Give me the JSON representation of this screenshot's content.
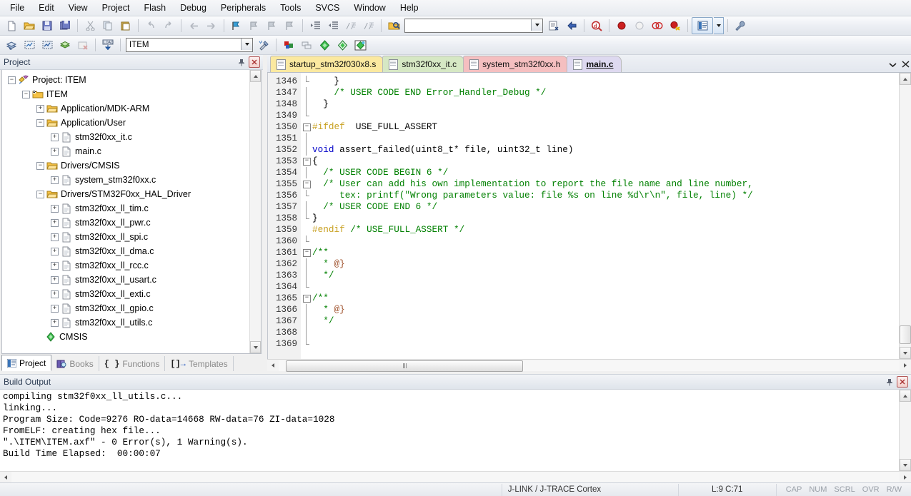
{
  "menubar": {
    "items": [
      "File",
      "Edit",
      "View",
      "Project",
      "Flash",
      "Debug",
      "Peripherals",
      "Tools",
      "SVCS",
      "Window",
      "Help"
    ]
  },
  "toolbar_main": {
    "icons": [
      {
        "name": "new-file-icon",
        "glyph": "⬜"
      },
      {
        "name": "open-file-icon",
        "glyph": "📂"
      },
      {
        "name": "save-icon",
        "glyph": "💾"
      },
      {
        "name": "save-all-icon",
        "glyph": "🖫"
      },
      {
        "name": "cut-icon",
        "glyph": "✂"
      },
      {
        "name": "copy-icon",
        "glyph": "⧉"
      },
      {
        "name": "paste-icon",
        "glyph": "📋"
      },
      {
        "name": "undo-icon",
        "glyph": "↶"
      },
      {
        "name": "redo-icon",
        "glyph": "↷"
      },
      {
        "name": "navigate-back-icon",
        "glyph": "⇦"
      },
      {
        "name": "navigate-forward-icon",
        "glyph": "⇨"
      },
      {
        "name": "bookmark-toggle-icon",
        "glyph": "⚑"
      },
      {
        "name": "bookmark-prev-icon",
        "glyph": "⚐"
      },
      {
        "name": "bookmark-next-icon",
        "glyph": "⚐"
      },
      {
        "name": "bookmark-clear-icon",
        "glyph": "⚐"
      },
      {
        "name": "indent-right-icon",
        "glyph": "⇥"
      },
      {
        "name": "indent-left-icon",
        "glyph": "⇤"
      },
      {
        "name": "comment-icon",
        "glyph": "//"
      },
      {
        "name": "uncomment-icon",
        "glyph": "//"
      }
    ],
    "find_in_files_icon": "find-in-files-icon",
    "search_box_value": "",
    "search_box_placeholder": "",
    "icons_right": [
      {
        "name": "insert-bookmark-icon",
        "glyph": "🗋"
      },
      {
        "name": "goto-definition-icon",
        "glyph": "✦"
      },
      {
        "name": "find-icon",
        "glyph": "🔍"
      },
      {
        "name": "breakpoint-insert-icon",
        "glyph": "●"
      },
      {
        "name": "breakpoint-disable-icon",
        "glyph": "○"
      },
      {
        "name": "breakpoint-disable-all-icon",
        "glyph": "⭕"
      },
      {
        "name": "breakpoint-kill-all-icon",
        "glyph": "●"
      }
    ],
    "window_layout_icon": "window-layout-icon",
    "configure_icon": "configure-tools-icon"
  },
  "toolbar_build": {
    "icons": [
      {
        "name": "translate-file-icon",
        "glyph": "◈"
      },
      {
        "name": "build-target-icon",
        "glyph": "▒"
      },
      {
        "name": "rebuild-all-icon",
        "glyph": "▓"
      },
      {
        "name": "batch-build-icon",
        "glyph": "⬛"
      },
      {
        "name": "stop-build-icon",
        "glyph": "☒"
      },
      {
        "name": "download-icon",
        "glyph": "LOAD"
      }
    ],
    "target_value": "ITEM",
    "icons_right": [
      {
        "name": "target-options-icon",
        "glyph": "⚒"
      },
      {
        "name": "manage-project-items-icon",
        "glyph": "▣"
      },
      {
        "name": "manage-multi-project-icon",
        "glyph": "❐"
      },
      {
        "name": "pack-installer-icon",
        "glyph": "◆"
      },
      {
        "name": "manage-runtime-env-icon",
        "glyph": "◇"
      },
      {
        "name": "select-software-packs-icon",
        "glyph": "◈"
      }
    ]
  },
  "project_pane": {
    "title": "Project",
    "pin_icon": "pin-icon",
    "close_icon": "close-icon",
    "tree": [
      {
        "depth": 0,
        "toggle": "minus",
        "icon": "project-icon",
        "label": "Project: ITEM"
      },
      {
        "depth": 1,
        "toggle": "minus",
        "icon": "target-icon",
        "label": "ITEM"
      },
      {
        "depth": 2,
        "toggle": "plus",
        "icon": "folder-icon",
        "label": "Application/MDK-ARM"
      },
      {
        "depth": 2,
        "toggle": "minus",
        "icon": "folder-icon",
        "label": "Application/User"
      },
      {
        "depth": 3,
        "toggle": "plus",
        "icon": "file-icon",
        "label": "stm32f0xx_it.c"
      },
      {
        "depth": 3,
        "toggle": "plus",
        "icon": "file-icon",
        "label": "main.c"
      },
      {
        "depth": 2,
        "toggle": "minus",
        "icon": "folder-icon",
        "label": "Drivers/CMSIS"
      },
      {
        "depth": 3,
        "toggle": "plus",
        "icon": "file-icon",
        "label": "system_stm32f0xx.c"
      },
      {
        "depth": 2,
        "toggle": "minus",
        "icon": "folder-icon",
        "label": "Drivers/STM32F0xx_HAL_Driver"
      },
      {
        "depth": 3,
        "toggle": "plus",
        "icon": "file-icon",
        "label": "stm32f0xx_ll_tim.c"
      },
      {
        "depth": 3,
        "toggle": "plus",
        "icon": "file-icon",
        "label": "stm32f0xx_ll_pwr.c"
      },
      {
        "depth": 3,
        "toggle": "plus",
        "icon": "file-icon",
        "label": "stm32f0xx_ll_spi.c"
      },
      {
        "depth": 3,
        "toggle": "plus",
        "icon": "file-icon",
        "label": "stm32f0xx_ll_dma.c"
      },
      {
        "depth": 3,
        "toggle": "plus",
        "icon": "file-icon",
        "label": "stm32f0xx_ll_rcc.c"
      },
      {
        "depth": 3,
        "toggle": "plus",
        "icon": "file-icon",
        "label": "stm32f0xx_ll_usart.c"
      },
      {
        "depth": 3,
        "toggle": "plus",
        "icon": "file-icon",
        "label": "stm32f0xx_ll_exti.c"
      },
      {
        "depth": 3,
        "toggle": "plus",
        "icon": "file-icon",
        "label": "stm32f0xx_ll_gpio.c"
      },
      {
        "depth": 3,
        "toggle": "plus",
        "icon": "file-icon",
        "label": "stm32f0xx_ll_utils.c"
      },
      {
        "depth": 2,
        "toggle": "none",
        "icon": "cmsis-icon",
        "label": "CMSIS"
      }
    ],
    "tabs": [
      {
        "label": "Project",
        "icon": "project-tab-icon",
        "active": true
      },
      {
        "label": "Books",
        "icon": "books-tab-icon",
        "active": false
      },
      {
        "label": "Functions",
        "icon": "functions-tab-icon",
        "active": false
      },
      {
        "label": "Templates",
        "icon": "templates-tab-icon",
        "active": false
      }
    ]
  },
  "editor": {
    "tabs": [
      {
        "label": "startup_stm32f030x8.s",
        "color": "#fbe9a0",
        "active": false
      },
      {
        "label": "stm32f0xx_it.c",
        "color": "#d6e8c4",
        "active": false
      },
      {
        "label": "system_stm32f0xx.h",
        "color": "#f5bfc0",
        "active": false
      },
      {
        "label": "main.c",
        "color": "#ded9f0",
        "active": true
      }
    ],
    "tab_list_icon": "tab-list-chevron-icon",
    "tab_close_icon": "tab-close-icon",
    "first_line_number": 1346,
    "lines": [
      {
        "n": 1346,
        "fold": "end",
        "html": "    }"
      },
      {
        "n": 1347,
        "fold": "bar",
        "html": "    <span class=\"c-com\">/* USER CODE END Error_Handler_Debug */</span>"
      },
      {
        "n": 1348,
        "fold": "bar",
        "html": "  }"
      },
      {
        "n": 1349,
        "fold": "endcap",
        "html": ""
      },
      {
        "n": 1350,
        "fold": "minus",
        "html": "<span class=\"c-pre\">#ifdef</span>  USE_FULL_ASSERT"
      },
      {
        "n": 1351,
        "fold": "bar",
        "html": ""
      },
      {
        "n": 1352,
        "fold": "bar",
        "html": "<span class=\"c-kw\">void</span> assert_failed(uint8_t* file, uint32_t line)"
      },
      {
        "n": 1353,
        "fold": "minus",
        "html": "{"
      },
      {
        "n": 1354,
        "fold": "bar",
        "html": "  <span class=\"c-com\">/* USER CODE BEGIN 6 */</span>"
      },
      {
        "n": 1355,
        "fold": "minus",
        "html": "  <span class=\"c-com\">/* User can add his own implementation to report the file name and line number,</span>"
      },
      {
        "n": 1356,
        "fold": "endcap",
        "html": "     <span class=\"c-com\">tex: printf(\"Wrong parameters value: file %s on line %d\\r\\n\", file, line) */</span>"
      },
      {
        "n": 1357,
        "fold": "bar",
        "html": "  <span class=\"c-com\">/* USER CODE END 6 */</span>"
      },
      {
        "n": 1358,
        "fold": "end",
        "html": "}"
      },
      {
        "n": 1359,
        "fold": "none",
        "html": "<span class=\"c-pre\">#endif</span> <span class=\"c-com\">/* USE_FULL_ASSERT */</span>"
      },
      {
        "n": 1360,
        "fold": "endcap2",
        "html": ""
      },
      {
        "n": 1361,
        "fold": "minus",
        "html": "<span class=\"c-com\">/**</span>"
      },
      {
        "n": 1362,
        "fold": "bar",
        "html": "  <span class=\"c-com\">*</span> <span class=\"c-doxy\">@}</span>"
      },
      {
        "n": 1363,
        "fold": "bar",
        "html": "  <span class=\"c-com\">*/</span>"
      },
      {
        "n": 1364,
        "fold": "end",
        "html": ""
      },
      {
        "n": 1365,
        "fold": "minus",
        "html": "<span class=\"c-com\">/**</span>"
      },
      {
        "n": 1366,
        "fold": "bar",
        "html": "  <span class=\"c-com\">*</span> <span class=\"c-doxy\">@}</span>"
      },
      {
        "n": 1367,
        "fold": "bar",
        "html": "  <span class=\"c-com\">*/</span>"
      },
      {
        "n": 1368,
        "fold": "bar",
        "html": ""
      },
      {
        "n": 1369,
        "fold": "end",
        "html": ""
      }
    ]
  },
  "build_output": {
    "title": "Build Output",
    "pin_icon": "pin-icon",
    "close_icon": "close-icon",
    "lines": [
      "compiling stm32f0xx_ll_utils.c...",
      "linking...",
      "Program Size: Code=9276 RO-data=14668 RW-data=76 ZI-data=1028",
      "FromELF: creating hex file...",
      "\".\\ITEM\\ITEM.axf\" - 0 Error(s), 1 Warning(s).",
      "Build Time Elapsed:  00:00:07"
    ]
  },
  "status_bar": {
    "debugger": "J-LINK / J-TRACE Cortex",
    "cursor": "L:9 C:71",
    "indicators": [
      "CAP",
      "NUM",
      "SCRL",
      "OVR",
      "R/W"
    ]
  }
}
